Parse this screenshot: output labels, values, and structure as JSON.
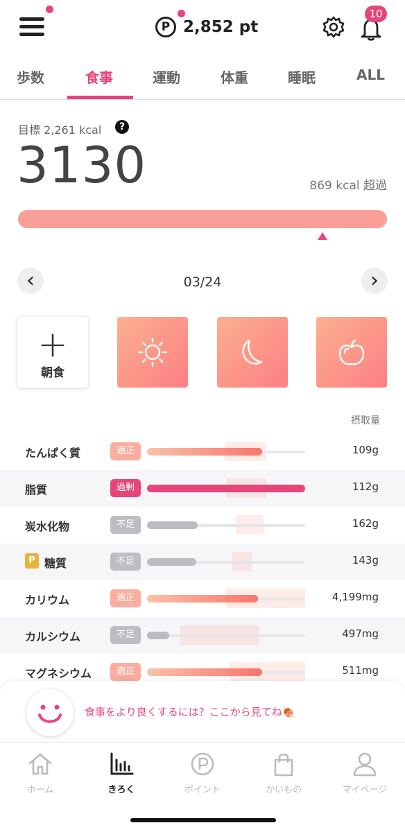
{
  "header": {
    "points_symbol": "P",
    "points_value": "2,852 pt",
    "notifications_count": "10",
    "accent": "#e8457a"
  },
  "tabs": [
    {
      "label": "歩数"
    },
    {
      "label": "食事",
      "active": true
    },
    {
      "label": "運動"
    },
    {
      "label": "体重"
    },
    {
      "label": "睡眠"
    },
    {
      "label": "ALL"
    }
  ],
  "summary": {
    "goal_label": "目標 2,261 kcal",
    "help_icon": "?",
    "total_kcal": "3130",
    "over_text": "869 kcal 超過",
    "goal_kcal": 2261,
    "total_value": 3130
  },
  "date_nav": {
    "date": "03/24",
    "prev_icon": "‹",
    "next_icon": "›"
  },
  "meals": {
    "add_label": "朝食",
    "add_icon": "+",
    "icons": [
      "sun-icon",
      "moon-icon",
      "apple-icon"
    ]
  },
  "nutrients": {
    "header": "摂取量",
    "rows": [
      {
        "name": "たんぱく質",
        "status": "適正",
        "amount": "109g",
        "level": 0.73
      },
      {
        "name": "脂質",
        "status": "過剰",
        "amount": "112g",
        "level": 1.0
      },
      {
        "name": "炭水化物",
        "status": "不足",
        "amount": "162g",
        "level": 0.32
      },
      {
        "name": "糖質",
        "status": "不足",
        "amount": "143g",
        "level": 0.31,
        "point_badge": "P"
      },
      {
        "name": "カリウム",
        "status": "適正",
        "amount": "4,199mg",
        "level": 0.7
      },
      {
        "name": "カルシウム",
        "status": "不足",
        "amount": "497mg",
        "level": 0.14
      },
      {
        "name": "マグネシウム",
        "status": "適正",
        "amount": "511mg",
        "level": 0.73
      }
    ]
  },
  "tip": {
    "text": "食事をより良くするには？ここから見てね🍖"
  },
  "bottom_nav": [
    {
      "label": "ホーム",
      "icon": "home-icon"
    },
    {
      "label": "きろく",
      "icon": "chart-icon",
      "active": true
    },
    {
      "label": "ポイント",
      "icon": "point-icon"
    },
    {
      "label": "かいもの",
      "icon": "shopping-bag-icon"
    },
    {
      "label": "マイページ",
      "icon": "user-icon"
    }
  ]
}
